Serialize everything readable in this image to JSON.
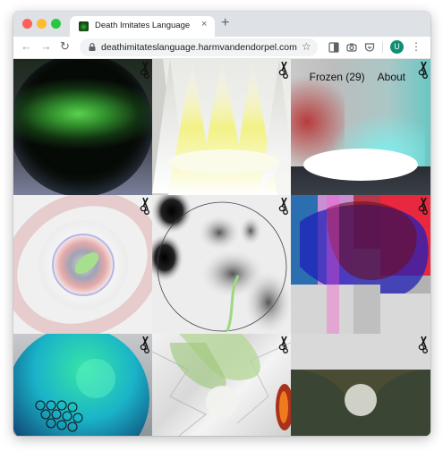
{
  "browser": {
    "tab_title": "Death Imitates Language",
    "tab_close": "×",
    "new_tab": "+",
    "url": "deathimitateslanguage.harmvandendorpel.com",
    "avatar_letter": "U",
    "back": "←",
    "forward": "→",
    "reload": "↻",
    "star": "☆",
    "menu": "⋮"
  },
  "site": {
    "nav": {
      "frozen": "Frozen (29)",
      "about": "About"
    }
  },
  "colors": {
    "traffic_red": "#ff5f57",
    "traffic_yellow": "#febc2e",
    "traffic_green": "#28c840",
    "avatar": "#0f8f74"
  },
  "gallery": {
    "tiles": [
      "tile-1",
      "tile-2",
      "tile-3",
      "tile-4",
      "tile-5",
      "tile-6",
      "tile-7",
      "tile-8",
      "tile-9"
    ]
  }
}
